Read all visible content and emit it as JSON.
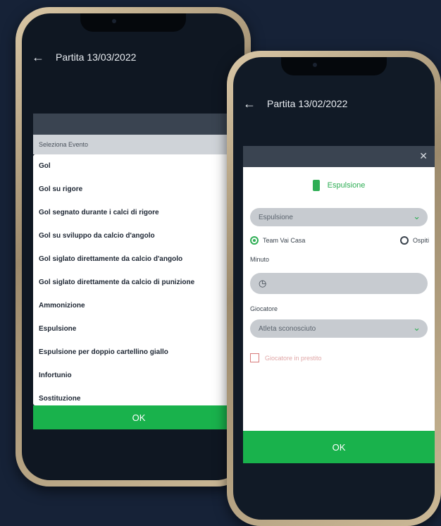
{
  "phone1": {
    "title": "Partita 13/03/2022",
    "select_text": "Seleziona Evento",
    "events": [
      "Gol",
      "Gol su rigore",
      "Gol segnato durante i calci di rigore",
      "Gol su sviluppo da calcio d'angolo",
      "Gol siglato direttamente da calcio d'angolo",
      "Gol siglato direttamente da calcio di punizione",
      "Ammonizione",
      "Espulsione",
      "Espulsione per doppio cartellino giallo",
      "Infortunio",
      "Sostituzione"
    ],
    "ok_label": "OK"
  },
  "phone2": {
    "title": "Partita 13/02/2022",
    "dialog_title": "Espulsione",
    "event_value": "Espulsione",
    "team_home": "Team Vai Casa",
    "team_away": "Ospiti",
    "minute_label": "Minuto",
    "player_label": "Giocatore",
    "player_value": "Atleta sconosciuto",
    "checkbox_label": "Giocatore in prestito",
    "ok_label": "OK"
  }
}
